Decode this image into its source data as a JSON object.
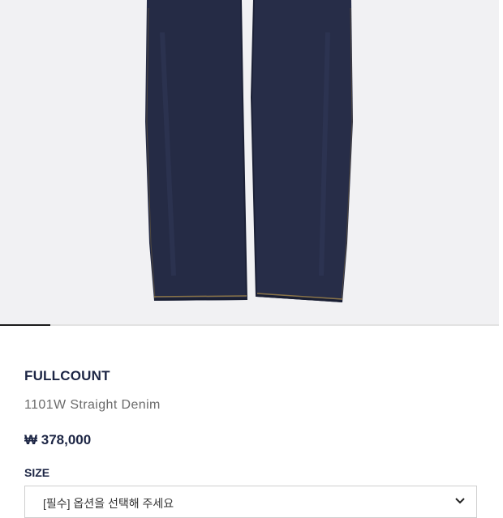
{
  "gallery": {
    "image_alt": "1101W Straight Denim",
    "background": "#f1f1f3",
    "denim_color": "#252b45",
    "slide_progress": 0.1
  },
  "product": {
    "brand": "FULLCOUNT",
    "name": "1101W Straight Denim",
    "price": "₩ 378,000"
  },
  "options": {
    "size_label": "SIZE",
    "size_select_value": "[필수] 옵션을 선택해 주세요"
  },
  "icons": {
    "select_arrow": "chevron-down-icon"
  },
  "colors": {
    "text_dark": "#1c2544",
    "text_muted": "#6b6b6b"
  }
}
